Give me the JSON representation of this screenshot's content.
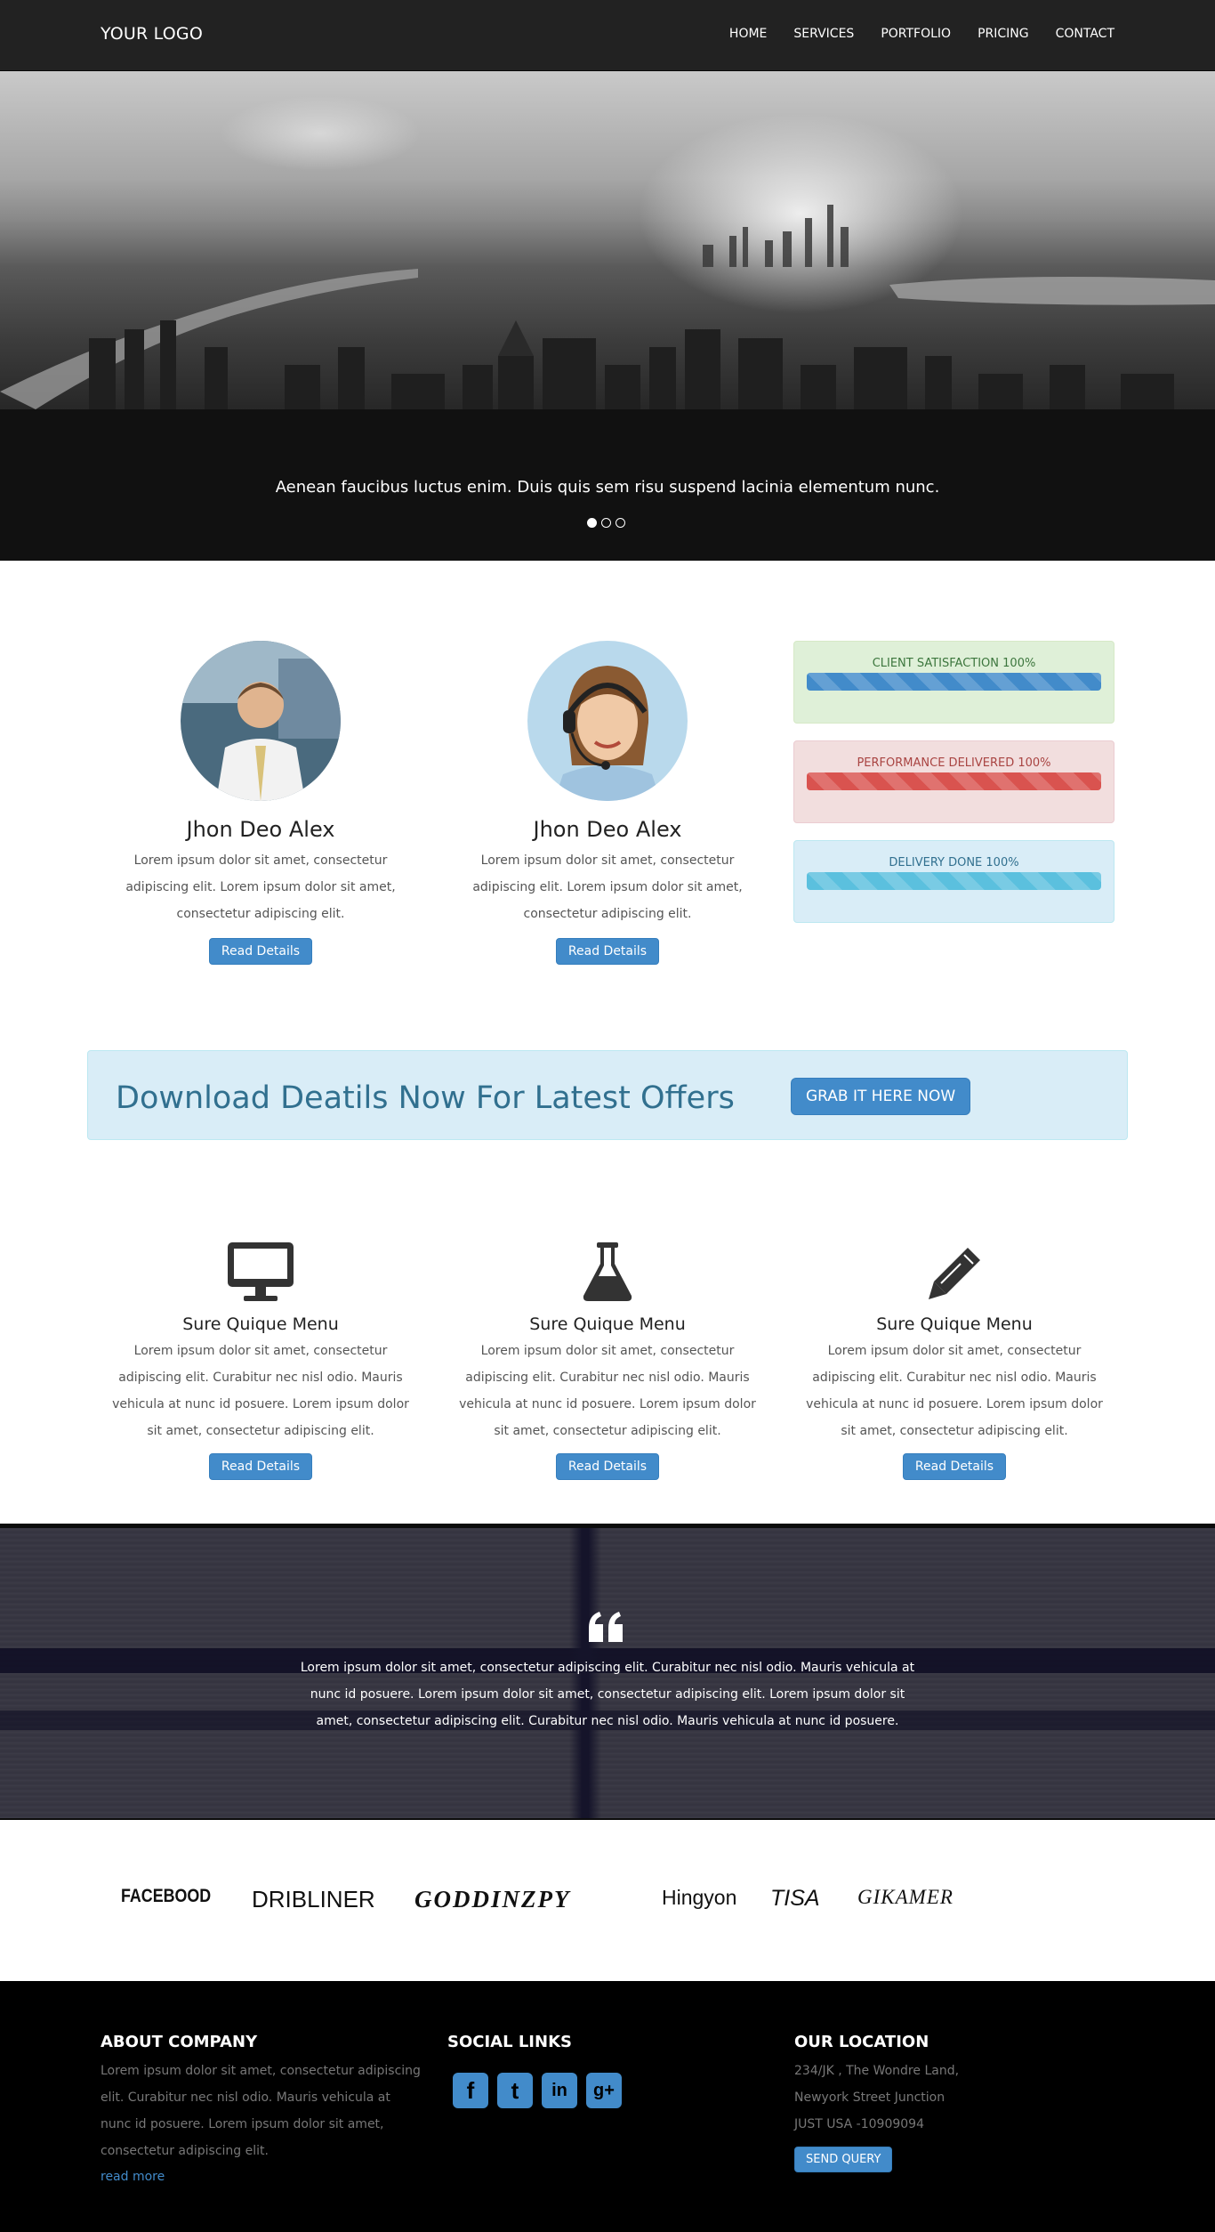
{
  "nav": {
    "logo": "YOUR LOGO",
    "links": [
      "HOME",
      "SERVICES",
      "PORTFOLIO",
      "PRICING",
      "CONTACT"
    ]
  },
  "hero": {
    "caption": "Aenean faucibus luctus enim. Duis quis sem risu suspend lacinia elementum nunc.",
    "slides": 3,
    "active_slide": 1
  },
  "team": [
    {
      "name": "Jhon Deo Alex",
      "description": "Lorem ipsum dolor sit amet, consectetur adipiscing elit. Lorem ipsum dolor sit amet, consectetur adipiscing elit.",
      "button": "Read Details"
    },
    {
      "name": "Jhon Deo Alex",
      "description": "Lorem ipsum dolor sit amet, consectetur adipiscing elit. Lorem ipsum dolor sit amet, consectetur adipiscing elit.",
      "button": "Read Details"
    }
  ],
  "stats": [
    {
      "label": "CLIENT SATISFACTION 100%",
      "percent": 100,
      "bg": "#dff0d8",
      "border": "#d6e9c6",
      "text": "#3c763d",
      "bar": "#428bca"
    },
    {
      "label": "PERFORMANCE DELIVERED 100%",
      "percent": 100,
      "bg": "#f2dede",
      "border": "#ebccd1",
      "text": "#a94442",
      "bar": "#d9534f"
    },
    {
      "label": "DELIVERY DONE 100%",
      "percent": 100,
      "bg": "#d9edf7",
      "border": "#bce8f1",
      "text": "#31708f",
      "bar": "#5bc0de"
    }
  ],
  "cta": {
    "text": "Download Deatils Now For Latest Offers",
    "button": "GRAB IT HERE NOW"
  },
  "services": [
    {
      "icon": "desktop-icon",
      "title": "Sure Quique Menu",
      "description": "Lorem ipsum dolor sit amet, consectetur adipiscing elit. Curabitur nec nisl odio. Mauris vehicula at nunc id posuere. Lorem ipsum dolor sit amet, consectetur adipiscing elit.",
      "button": "Read Details"
    },
    {
      "icon": "flask-icon",
      "title": "Sure Quique Menu",
      "description": "Lorem ipsum dolor sit amet, consectetur adipiscing elit. Curabitur nec nisl odio. Mauris vehicula at nunc id posuere. Lorem ipsum dolor sit amet, consectetur adipiscing elit.",
      "button": "Read Details"
    },
    {
      "icon": "pencil-icon",
      "title": "Sure Quique Menu",
      "description": "Lorem ipsum dolor sit amet, consectetur adipiscing elit. Curabitur nec nisl odio. Mauris vehicula at nunc id posuere. Lorem ipsum dolor sit amet, consectetur adipiscing elit.",
      "button": "Read Details"
    }
  ],
  "testimonial": {
    "icon": "quote-icon",
    "text": "Lorem ipsum dolor sit amet, consectetur adipiscing elit. Curabitur nec nisl odio. Mauris vehicula at nunc id posuere. Lorem ipsum dolor sit amet, consectetur adipiscing elit. Lorem ipsum dolor sit amet, consectetur adipiscing elit. Curabitur nec nisl odio. Mauris vehicula at nunc id posuere."
  },
  "brands": [
    "FACEBOOD",
    "DRIBLINER",
    "GODDINZPY",
    "Hingyon",
    "TISA",
    "GIKAMER"
  ],
  "footer": {
    "about": {
      "heading": "ABOUT COMPANY",
      "text": "Lorem ipsum dolor sit amet, consectetur adipiscing elit. Curabitur nec nisl odio. Mauris vehicula at nunc id posuere. Lorem ipsum dolor sit amet, consectetur adipiscing elit.",
      "link": "read more"
    },
    "social": {
      "heading": "SOCIAL LINKS",
      "icons": [
        "facebook-icon",
        "twitter-icon",
        "linkedin-icon",
        "google-plus-icon"
      ],
      "glyphs": [
        "f",
        "t",
        "in",
        "g+"
      ]
    },
    "location": {
      "heading": "OUR LOCATION",
      "lines": [
        "234/JK , The Wondre Land,",
        "Newyork Street Junction",
        "JUST USA -10909094"
      ],
      "button": "SEND QUERY"
    }
  },
  "colors": {
    "primary": "#428bca",
    "navbar": "#222222",
    "footer": "#000000"
  }
}
